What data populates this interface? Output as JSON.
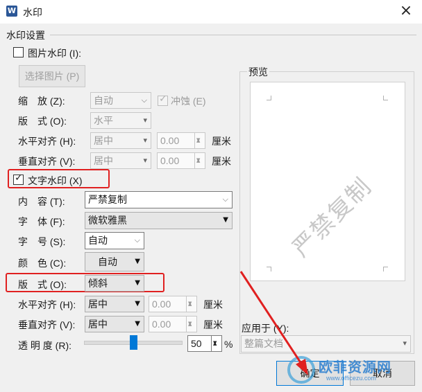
{
  "dialog": {
    "title": "水印",
    "app_icon": "W"
  },
  "group": {
    "label": "水印设置"
  },
  "picture": {
    "checkbox_label": "图片水印 (I):",
    "select_button": "选择图片 (P)",
    "scale_label": "缩　放 (Z):",
    "scale_value": "自动",
    "washout_label": "冲蚀 (E)",
    "layout_label": "版　式 (O):",
    "layout_value": "水平",
    "halign_label": "水平对齐 (H):",
    "halign_value": "居中",
    "halign_offset": "0.00",
    "valign_label": "垂直对齐 (V):",
    "valign_value": "居中",
    "valign_offset": "0.00",
    "unit": "厘米"
  },
  "text": {
    "checkbox_label": "文字水印 (X)",
    "content_label": "内　容 (T):",
    "content_value": "严禁复制",
    "font_label": "字　体 (F):",
    "font_value": "微软雅黑",
    "size_label": "字　号 (S):",
    "size_value": "自动",
    "color_label": "颜　色 (C):",
    "color_value": "自动",
    "layout_label": "版　式 (O):",
    "layout_value": "倾斜",
    "halign_label": "水平对齐 (H):",
    "halign_value": "居中",
    "halign_offset": "0.00",
    "valign_label": "垂直对齐 (V):",
    "valign_value": "居中",
    "valign_offset": "0.00",
    "unit": "厘米",
    "transparency_label": "透 明 度 (R):",
    "transparency_value": "50",
    "transparency_unit": "%",
    "transparency_level": 0.5
  },
  "preview": {
    "label": "预览",
    "watermark_text": "严禁复制"
  },
  "apply": {
    "label": "应用于 (Y):",
    "value": "整篇文档"
  },
  "buttons": {
    "ok": "确定",
    "cancel": "取消"
  },
  "overlay": {
    "logo_text": "欧菲资源网",
    "logo_url_text": "www.officezu.com"
  },
  "icons": [
    "close-icon",
    "chevron-down-icon",
    "spinner-up-icon",
    "spinner-down-icon",
    "checkmark-icon",
    "arrow-annotation-icon"
  ],
  "colors": {
    "annotation_red": "#e02020",
    "slider_blue": "#0078d7",
    "watermark_gray": "#c8c8c8"
  }
}
